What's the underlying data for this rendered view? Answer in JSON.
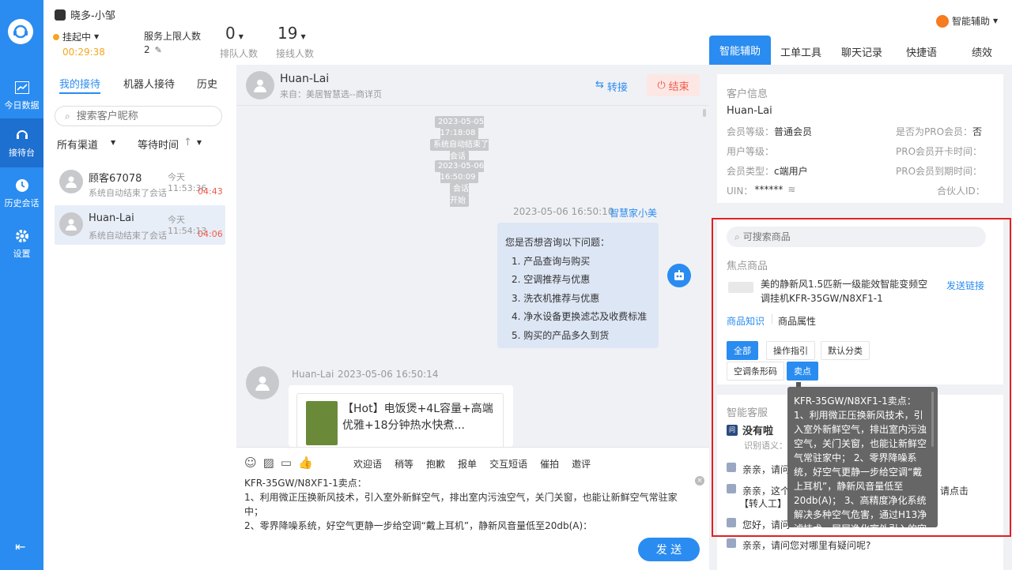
{
  "nav": {
    "items": [
      {
        "label": "今日数据",
        "icon": "chart-icon"
      },
      {
        "label": "接待台",
        "icon": "headset-icon"
      },
      {
        "label": "历史会话",
        "icon": "clock-icon"
      },
      {
        "label": "设置",
        "icon": "gear-icon"
      }
    ]
  },
  "header": {
    "agent_name": "晓多-小邹",
    "status": "挂起中",
    "timer": "00:29:38",
    "service_limit_label": "服务上限人数",
    "service_limit_value": "2",
    "queue_value": "0",
    "queue_label": "排队人数",
    "connected_value": "19",
    "connected_label": "接线人数",
    "assistant_label": "智能辅助"
  },
  "right_tabs": [
    "智能辅助",
    "工单工具",
    "聊天记录",
    "快捷语",
    "绩效"
  ],
  "session_list": {
    "tabs": [
      "我的接待",
      "机器人接待",
      "历史"
    ],
    "search_placeholder": "搜索客户昵称",
    "filter_channel": "所有渠道",
    "filter_wait": "等待时间",
    "items": [
      {
        "name": "顾客67078",
        "time": "今天 11:53:36",
        "preview": "系统自动结束了会话",
        "wait": "04:43"
      },
      {
        "name": "Huan-Lai",
        "time": "今天 11:54:13",
        "preview": "系统自动结束了会话",
        "wait": "04:06"
      }
    ]
  },
  "chat": {
    "customer_name": "Huan-Lai",
    "source": "来自：美居智慧选--商详页",
    "transfer_label": "转接",
    "end_label": "结束",
    "system_msgs": [
      "2023-05-05 17:18:08",
      "系统自动结束了会话",
      "2023-05-06 16:50:09",
      "会话开始"
    ],
    "bot_time": "2023-05-06 16:50:10",
    "bot_name": "智慧家小美",
    "bot_intro": "您是否想咨询以下问题：",
    "bot_items": [
      "1. 产品查询与购买",
      "2. 空调推荐与优惠",
      "3. 洗衣机推荐与优惠",
      "4. 净水设备更换滤芯及收费标准",
      "5. 购买的产品多久到货"
    ],
    "customer_msg_name": "Huan-Lai",
    "customer_msg_time": "2023-05-06 16:50:14",
    "product_card_text": "【Hot】电饭煲+4L容量+高端优雅+18分钟热水快煮...",
    "quick_links": [
      "欢迎语",
      "稍等",
      "抱歉",
      "报单",
      "交互短语",
      "催拍",
      "邀评"
    ],
    "input_lines": [
      "KFR-35GW/N8XF1-1卖点：",
      "1、利用微正压换新风技术，引入室外新鲜空气，排出室内污浊空气，关门关窗，也能让新鲜空气常驻家中；",
      "2、零界降噪系统，好空气更静一步给空调“戴上耳机”，静新风音量低至20db(A)："
    ],
    "send_label": "发 送"
  },
  "customer_info": {
    "title": "客户信息",
    "name": "Huan-Lai",
    "member_level_label": "会员等级：",
    "member_level": "普通会员",
    "is_pro_label": "是否为PRO会员：",
    "is_pro": "否",
    "user_level_label": "用户等级：",
    "pro_open_label": "PRO会员开卡时间：",
    "member_type_label": "会员类型：",
    "member_type": "c端用户",
    "pro_expire_label": "PRO会员到期时间：",
    "uin_label": "UIN：",
    "uin": "******",
    "partner_label": "合伙人ID："
  },
  "product": {
    "search_placeholder": "可搜索商品",
    "focus_title": "焦点商品",
    "name": "美的静新风1.5匹新一级能效智能变频空调挂机KFR-35GW/N8XF1-1",
    "send_link": "发送链接",
    "tabs": [
      "商品知识",
      "商品属性"
    ],
    "chips": [
      "全部",
      "操作指引",
      "默认分类",
      "空调条形码",
      "卖点"
    ]
  },
  "smart": {
    "title": "智能客服",
    "no_result": "没有啦",
    "intent_label": "识别语义：",
    "replies": [
      "亲亲，请问",
      "亲亲，这个",
      "【转人工】",
      "您好，请问",
      "亲亲，请问您对哪里有疑问呢?"
    ],
    "reply_suffix": "请点击"
  },
  "tooltip": {
    "text": "KFR-35GW/N8XF1-1卖点：\n1、利用微正压换新风技术，引入室外新鲜空气，排出室内污浊空气，关门关窗，也能让新鲜空气常驻家中； 2、零界降噪系统，好空气更静一步给空调“戴上耳机”，静新风音量低至20db(A)； 3、高精度净化系统解决多种空气危害，通过H13净滤技术，层层净化室外引入的空气，更"
  },
  "colors": {
    "accent": "#2a8cf0",
    "highlight": "#e02020",
    "danger": "#f25a4a",
    "timer": "#f5a623"
  }
}
